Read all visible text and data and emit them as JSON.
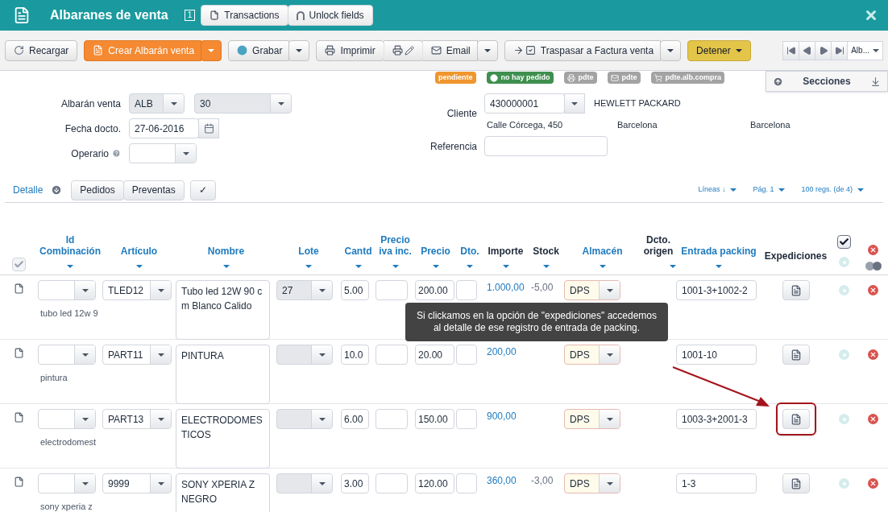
{
  "window": {
    "title": "Albaranes de venta",
    "badge": "1",
    "buttons": [
      {
        "label": "Transactions"
      },
      {
        "label": "Unlock fields"
      }
    ]
  },
  "toolbar": {
    "buttons": [
      {
        "label": "Recargar",
        "kind": "default",
        "dropdown": false,
        "joined": false
      },
      {
        "label": "Crear Albarán venta",
        "kind": "primary",
        "dropdown": true,
        "joined": false
      },
      {
        "label": "Grabar",
        "kind": "default",
        "dropdown": true,
        "joined": false
      },
      {
        "label": "Imprimir",
        "kind": "default",
        "dropdown": false,
        "joined": false
      },
      {
        "kind": "icon",
        "dropdown": false,
        "joined": true
      },
      {
        "label": "Email",
        "kind": "default",
        "dropdown": true,
        "joined": true
      },
      {
        "label": "Traspasar a Factura venta",
        "kind": "default",
        "dropdown": true,
        "joined": false
      },
      {
        "label": "Detener",
        "kind": "warning",
        "dropdown": true,
        "joined": false
      }
    ],
    "nav_select": "Alb..."
  },
  "status_badges": [
    {
      "label": "pendiente",
      "color": "#f0962e"
    },
    {
      "label": "no hay pedido",
      "color": "#3f8f4f"
    },
    {
      "label": "pdte",
      "color": "#a3a3a3"
    },
    {
      "label": "pdte",
      "color": "#a3a3a3"
    },
    {
      "label": "pdte.alb.compra",
      "color": "#a3a3a3"
    }
  ],
  "sections_panel": {
    "title": "Secciones"
  },
  "form": {
    "albaran_label": "Albarán venta",
    "serie": "ALB",
    "numero": "30",
    "fecha_label": "Fecha docto.",
    "fecha": "27-06-2016",
    "operario_label": "Operario",
    "cliente_label": "Cliente",
    "cliente": "430000001",
    "cliente_nombre": "HEWLETT PACKARD",
    "direccion": [
      "Calle Córcega, 450",
      "Barcelona",
      "Barcelona"
    ],
    "referencia_label": "Referencia"
  },
  "detail_bar": {
    "title": "Detalle",
    "buttons": [
      {
        "label": "Pedidos"
      },
      {
        "label": "Preventas"
      },
      {
        "label": "✓"
      }
    ],
    "pager": [
      {
        "label": "Líneas ↓"
      },
      {
        "label": "Pág. 1"
      },
      {
        "label": "100 regs. (de 4)"
      }
    ]
  },
  "table": {
    "select_all": {
      "checked": true
    },
    "right_check": {
      "checked": true
    },
    "columns": [
      {
        "label": "Id Combinación",
        "sortable": true,
        "filter": true
      },
      {
        "label": "Artículo",
        "sortable": true,
        "filter": true
      },
      {
        "label": "Nombre",
        "sortable": true,
        "filter": true
      },
      {
        "label": "Lote",
        "sortable": true,
        "filter": true
      },
      {
        "label": "Cantd",
        "sortable": true,
        "filter": true
      },
      {
        "label": "Precio iva inc.",
        "sortable": true,
        "filter": true
      },
      {
        "label": "Precio",
        "sortable": true,
        "filter": true
      },
      {
        "label": "Dto.",
        "sortable": true,
        "filter": true
      },
      {
        "label": "Importe",
        "sortable": false,
        "filter": true
      },
      {
        "label": "Stock",
        "sortable": false,
        "filter": true
      },
      {
        "label": "Almacén",
        "sortable": true,
        "filter": true
      },
      {
        "label": "Dcto. origen",
        "sortable": false,
        "filter": true
      },
      {
        "label": "Entrada packing",
        "sortable": true,
        "filter": true
      },
      {
        "label": "Expediciones",
        "sortable": false,
        "filter": false
      }
    ],
    "rows": [
      {
        "description": "tubo led 12w 9",
        "articulo": "TLED12",
        "nombre": "Tubo led 12W 90 cm Blanco Calido",
        "lote": "27",
        "cantd": "5.00",
        "precio": "200.00",
        "importe": "1.000,00",
        "stock": "-5,00",
        "almacen": "DPS",
        "entrada_packing": "1001-3+1002-2",
        "highlighted": false
      },
      {
        "description": "pintura",
        "articulo": "PART11",
        "nombre": "PINTURA",
        "cantd": "10.0",
        "precio": "20.00",
        "importe": "200,00",
        "almacen": "DPS",
        "entrada_packing": "1001-10",
        "highlighted": false
      },
      {
        "description": "electrodomest",
        "articulo": "PART13",
        "nombre": "ELECTRODOMESTICOS",
        "cantd": "6.00",
        "precio": "150.00",
        "importe": "900,00",
        "almacen": "DPS",
        "entrada_packing": "1003-3+2001-3",
        "highlighted": true
      },
      {
        "description": "sony xperia z",
        "articulo": "9999",
        "nombre": "SONY XPERIA Z NEGRO",
        "cantd": "3.00",
        "precio": "120.00",
        "importe": "360,00",
        "stock": "-3,00",
        "almacen": "DPS",
        "entrada_packing": "1-3",
        "highlighted": false
      }
    ]
  },
  "tooltip": {
    "text": "Si clickamos en la opción de \"expediciones\" accedemos al detalle de ese registro de entrada de packing."
  }
}
